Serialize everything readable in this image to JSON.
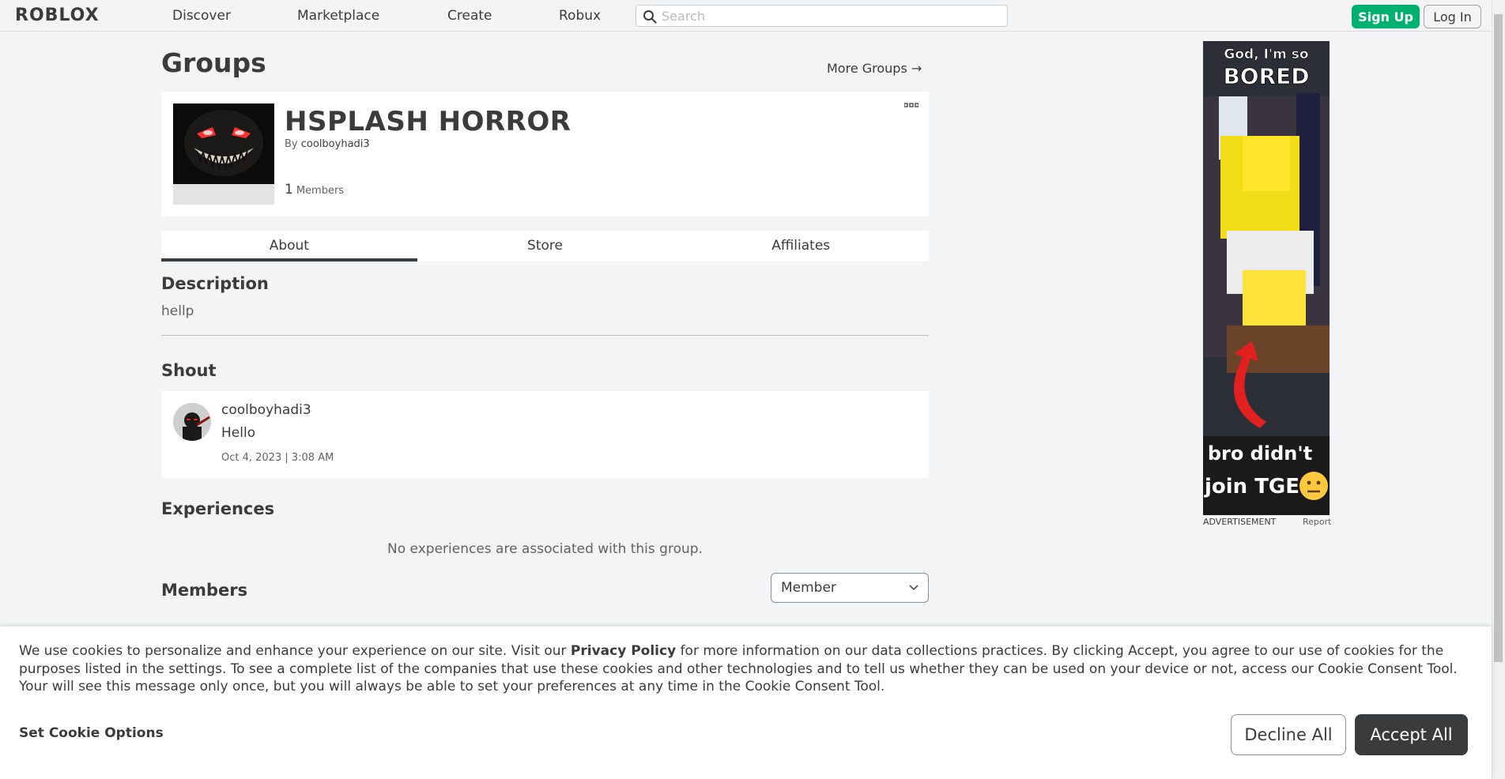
{
  "header": {
    "logo_text": "ROBLOX",
    "nav": [
      "Discover",
      "Marketplace",
      "Create",
      "Robux"
    ],
    "search_placeholder": "Search",
    "signup_label": "Sign Up",
    "login_label": "Log In"
  },
  "page": {
    "title": "Groups",
    "more_groups_label": "More Groups →"
  },
  "group": {
    "name": "HSPLASH HORROR",
    "by_prefix": "By",
    "owner": "coolboyhadi3",
    "member_count": "1",
    "member_label": "Members"
  },
  "tabs": [
    {
      "label": "About",
      "active": true
    },
    {
      "label": "Store",
      "active": false
    },
    {
      "label": "Affiliates",
      "active": false
    }
  ],
  "about": {
    "description_heading": "Description",
    "description_text": "hellp",
    "shout_heading": "Shout",
    "shout": {
      "user": "coolboyhadi3",
      "text": "Hello",
      "date": "Oct 4, 2023 | 3:08 AM"
    },
    "experiences_heading": "Experiences",
    "no_experiences_text": "No experiences are associated with this group.",
    "members_heading": "Members",
    "role_selected": "Member"
  },
  "ad": {
    "top_text_line1": "God, I'm so",
    "top_text_line2": "BORED",
    "bottom_text_line1": "bro didn't",
    "bottom_text_line2": "join TGE",
    "label": "ADVERTISEMENT",
    "report": "Report"
  },
  "cookie": {
    "text_before_link": "We use cookies to personalize and enhance your experience on our site. Visit our ",
    "privacy_link": "Privacy Policy",
    "text_after_link": " for more information on our data collections practices. By clicking Accept, you agree to our use of cookies for the purposes listed in the settings. To see a complete list of the companies that use these cookies and other technologies and to tell us whether they can be used on your device or not, access our Cookie Consent Tool. Your will see this message only once, but you will always be able to set your preferences at any time in the Cookie Consent Tool.",
    "options_label": "Set Cookie Options",
    "decline_label": "Decline All",
    "accept_label": "Accept All"
  },
  "colors": {
    "page_bg": "#f2f4f5",
    "text_primary": "#393b3d",
    "signup_green": "#00b06f",
    "accept_dark": "#393b3d"
  }
}
